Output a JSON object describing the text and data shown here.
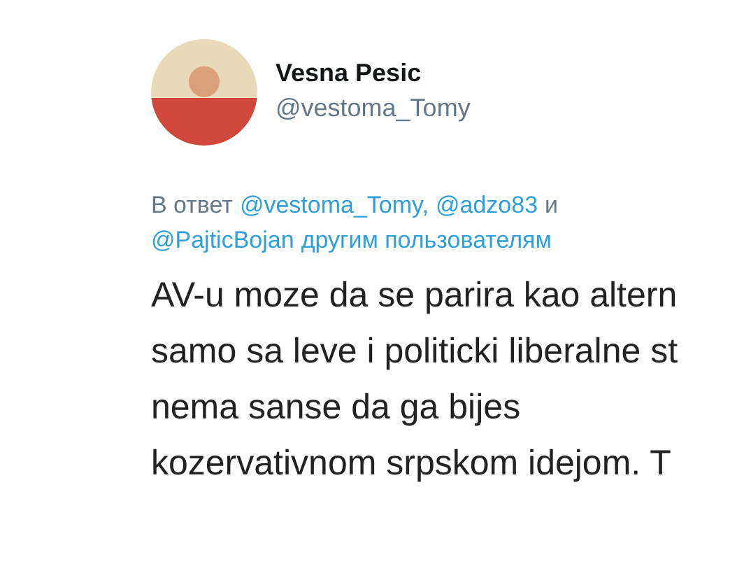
{
  "author": {
    "name": "Vesna Pesic",
    "handle": "@vestoma_Tomy"
  },
  "reply_to": {
    "lines": [
      [
        {
          "kind": "text",
          "text": "В ответ"
        },
        {
          "kind": "link",
          "text": "@vestoma_Tomy,"
        },
        {
          "kind": "link",
          "text": "@adzo83"
        },
        {
          "kind": "text",
          "text": "и"
        }
      ],
      [
        {
          "kind": "link",
          "text": "@PajticBojan"
        },
        {
          "kind": "link",
          "text": "другим пользователям"
        }
      ]
    ]
  },
  "body_lines": [
    "AV-u moze da se parira kao altern",
    "samo sa leve i politicki liberalne st",
    "nema sanse da ga bijes",
    "kozervativnom srpskom idejom. T"
  ]
}
